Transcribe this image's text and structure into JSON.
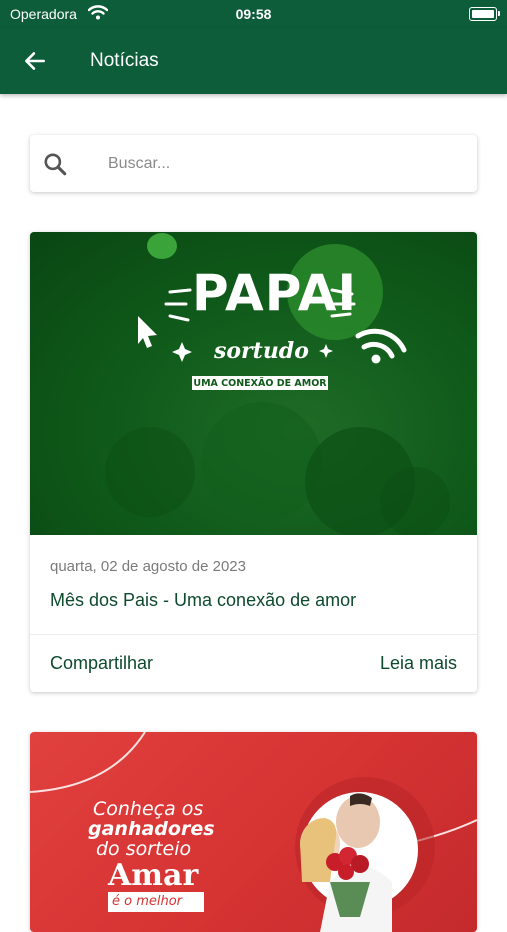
{
  "status_bar": {
    "carrier": "Operadora",
    "time": "09:58",
    "icons": [
      "wifi-icon",
      "battery-icon"
    ]
  },
  "app_bar": {
    "title": "Notícias",
    "back_icon": "arrow-back-icon",
    "color": "#0d5c3a"
  },
  "search": {
    "placeholder": "Buscar...",
    "value": "",
    "icon": "search-icon"
  },
  "news": [
    {
      "banner": {
        "headline": "PAPAI",
        "script_text": "sortudo",
        "tagline": "UMA CONEXÃO DE AMOR",
        "background": "#0f5a1a"
      },
      "date": "quarta, 02 de agosto de 2023",
      "title": "Mês dos Pais - Uma conexão de amor",
      "share_label": "Compartilhar",
      "read_more_label": "Leia mais"
    },
    {
      "banner": {
        "line1": "Conheça os",
        "line2": "ganhadores",
        "line3": "do sorteio",
        "line4": "Amar",
        "line5": "é o melhor",
        "background": "#d63333"
      }
    }
  ],
  "colors": {
    "primary": "#0d5c3a",
    "text_dark": "#0d4a2e",
    "text_muted": "#7a7a7a"
  }
}
